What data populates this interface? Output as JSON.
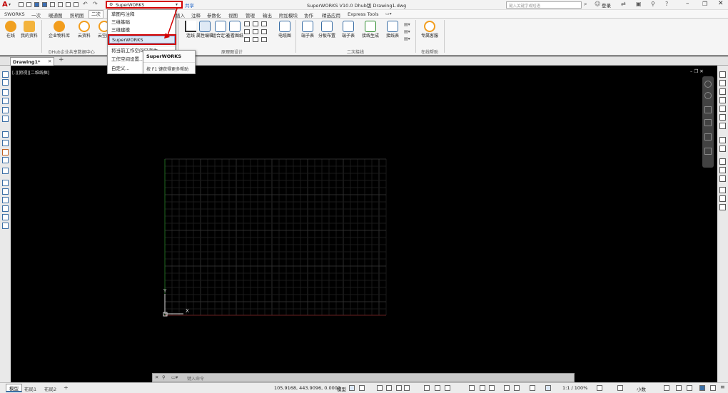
{
  "app": {
    "logo": "A",
    "title": "SuperWORKS V10.0 Dhub版    Drawing1.dwg",
    "share": "共享",
    "search_placeholder": "键入关键字或短语",
    "login": "登录",
    "accent": "#c00000"
  },
  "workspace": {
    "current": "SuperWORKS",
    "options": [
      "草图与注释",
      "三维基础",
      "三维建模",
      "SuperWORKS",
      "将当前工作空间另存为...",
      "工作空间设置...",
      "自定义..."
    ],
    "highlighted_index": 3
  },
  "tooltip": {
    "title": "SuperWORKS",
    "hint": "按 F1 键获得更多帮助"
  },
  "menu": {
    "tabs": [
      "SWORKS",
      "一次",
      "暖通图",
      "照明图",
      "二次",
      "插入",
      "注释",
      "参数化",
      "视图",
      "管理",
      "输出",
      "附加模块",
      "协作",
      "精选应用",
      "Express Tools"
    ],
    "active_index": 4
  },
  "ribbon": {
    "buttons": [
      "在线",
      "我的资料",
      "企业物料库",
      "云资料",
      "云空间",
      "连线",
      "属性编辑",
      "组合定义",
      "查看图纸",
      "电缆图",
      "端子表",
      "分板布置",
      "端子表",
      "接线生成",
      "接线表",
      "专属客服"
    ],
    "groups": [
      "DHub企业共享数据中心",
      "原理图设计",
      "二次接线",
      "在线帮助"
    ]
  },
  "doc_tabs": {
    "tabs": [
      "Drawing1*"
    ],
    "add": "+"
  },
  "viewport": {
    "label": "[-][俯视][二维线框]",
    "axis_y": "Y",
    "axis_x": "X"
  },
  "command": {
    "placeholder": "键入命令"
  },
  "layout_tabs": [
    "模型",
    "布局1",
    "布局2"
  ],
  "status": {
    "coords": "105.9168, 443.9096, 0.0000",
    "model": "模型",
    "scale": "1:1 / 100%",
    "units": "小数"
  }
}
